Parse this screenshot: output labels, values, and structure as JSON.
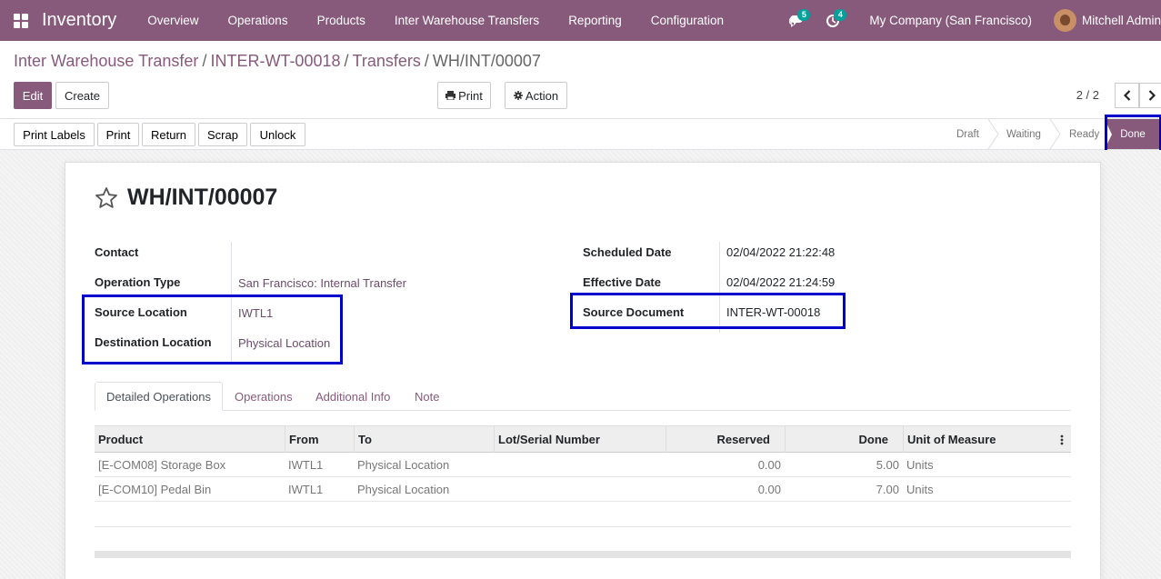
{
  "navbar": {
    "app_name": "Inventory",
    "menu": [
      "Overview",
      "Operations",
      "Products",
      "Inter Warehouse Transfers",
      "Reporting",
      "Configuration"
    ],
    "messages_count": "5",
    "activities_count": "4",
    "company": "My Company (San Francisco)",
    "user": "Mitchell Admin"
  },
  "breadcrumb": [
    "Inter Warehouse Transfer",
    "INTER-WT-00018",
    "Transfers",
    "WH/INT/00007"
  ],
  "buttons": {
    "edit": "Edit",
    "create": "Create",
    "print": "Print",
    "action": "Action"
  },
  "pager": "2 / 2",
  "statusbar": {
    "actions": [
      "Print Labels",
      "Print",
      "Return",
      "Scrap",
      "Unlock"
    ],
    "stages": [
      "Draft",
      "Waiting",
      "Ready",
      "Done"
    ],
    "current_stage": "Done"
  },
  "record": {
    "name": "WH/INT/00007",
    "left_fields": [
      {
        "label": "Contact",
        "value": ""
      },
      {
        "label": "Operation Type",
        "value": "San Francisco: Internal Transfer"
      },
      {
        "label": "Source Location",
        "value": "IWTL1"
      },
      {
        "label": "Destination Location",
        "value": "Physical Location"
      }
    ],
    "right_fields": [
      {
        "label": "Scheduled Date",
        "value": "02/04/2022 21:22:48"
      },
      {
        "label": "Effective Date",
        "value": "02/04/2022 21:24:59"
      },
      {
        "label": "Source Document",
        "value": "INTER-WT-00018"
      }
    ]
  },
  "tabs": [
    "Detailed Operations",
    "Operations",
    "Additional Info",
    "Note"
  ],
  "table": {
    "headers": [
      "Product",
      "From",
      "To",
      "Lot/Serial Number",
      "Reserved",
      "Done",
      "Unit of Measure"
    ],
    "rows": [
      [
        "[E-COM08] Storage Box",
        "IWTL1",
        "Physical Location",
        "",
        "0.00",
        "5.00",
        "Units"
      ],
      [
        "[E-COM10] Pedal Bin",
        "IWTL1",
        "Physical Location",
        "",
        "0.00",
        "7.00",
        "Units"
      ]
    ]
  },
  "colors": {
    "brand": "#875a7b",
    "badge": "#00a09d",
    "highlight": "#0000cc"
  }
}
